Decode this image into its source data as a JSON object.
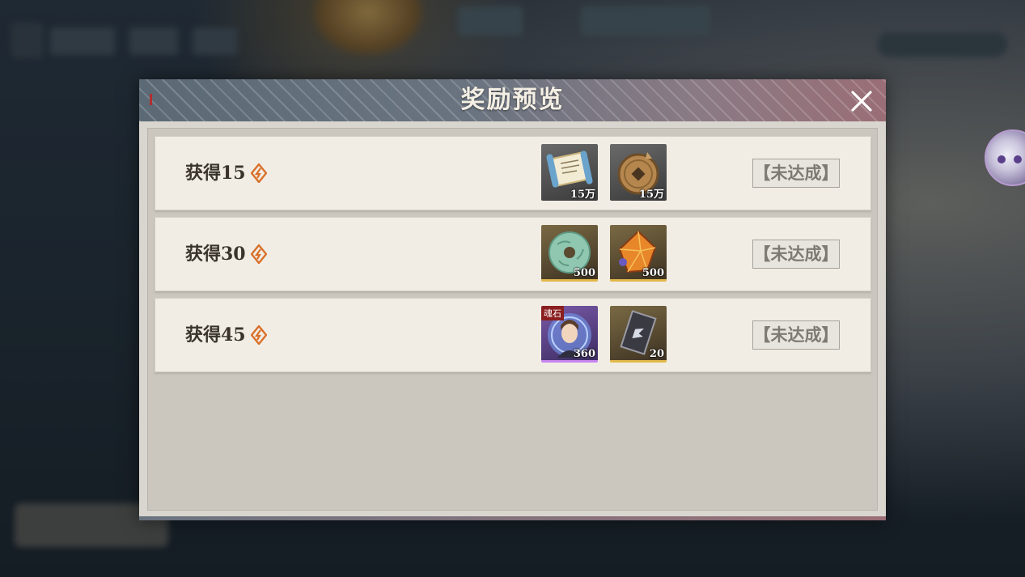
{
  "dialog": {
    "title": "奖励预览",
    "rows": [
      {
        "label": "获得15",
        "items": [
          {
            "icon": "scroll-icon",
            "count": "15万",
            "rarity": "gray"
          },
          {
            "icon": "coin-icon",
            "count": "15万",
            "rarity": "gray"
          }
        ],
        "status": "【未达成】"
      },
      {
        "label": "获得30",
        "items": [
          {
            "icon": "jade-disc-icon",
            "count": "500",
            "rarity": "gold"
          },
          {
            "icon": "amber-crystal-icon",
            "count": "500",
            "rarity": "gold"
          }
        ],
        "status": "【未达成】"
      },
      {
        "label": "获得45",
        "items": [
          {
            "icon": "character-portrait-icon",
            "tag": "魂石",
            "count": "360",
            "rarity": "purple"
          },
          {
            "icon": "token-card-icon",
            "count": "20",
            "rarity": "gold"
          }
        ],
        "status": "【未达成】"
      }
    ]
  },
  "colors": {
    "currency_icon": "#d9702a",
    "title_text": "#f4efe4",
    "status_text": "#7e7a73"
  }
}
